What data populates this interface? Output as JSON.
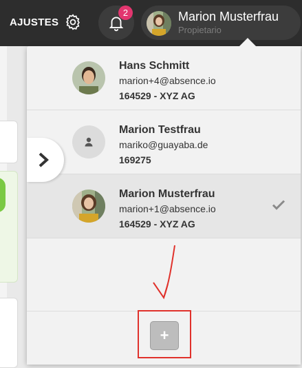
{
  "topbar": {
    "settings_label": "AJUSTES",
    "notifications_count": "2",
    "user_name": "Marion Musterfrau",
    "user_role": "Propietario"
  },
  "accounts": [
    {
      "name": "Hans Schmitt",
      "email": "marion+4@absence.io",
      "org": "164529 - XYZ AG",
      "avatar": "photo-man"
    },
    {
      "name": "Marion Testfrau",
      "email": "mariko@guayaba.de",
      "org": "169275",
      "avatar": "placeholder-person-icon"
    },
    {
      "name": "Marion Musterfrau",
      "email": "marion+1@absence.io",
      "org": "164529 - XYZ AG",
      "avatar": "photo-woman",
      "current": true
    }
  ],
  "footer": {
    "add_label": "+"
  },
  "colors": {
    "topbar": "#2d2d2d",
    "badge": "#e2366f",
    "annotation": "#e0312b"
  }
}
